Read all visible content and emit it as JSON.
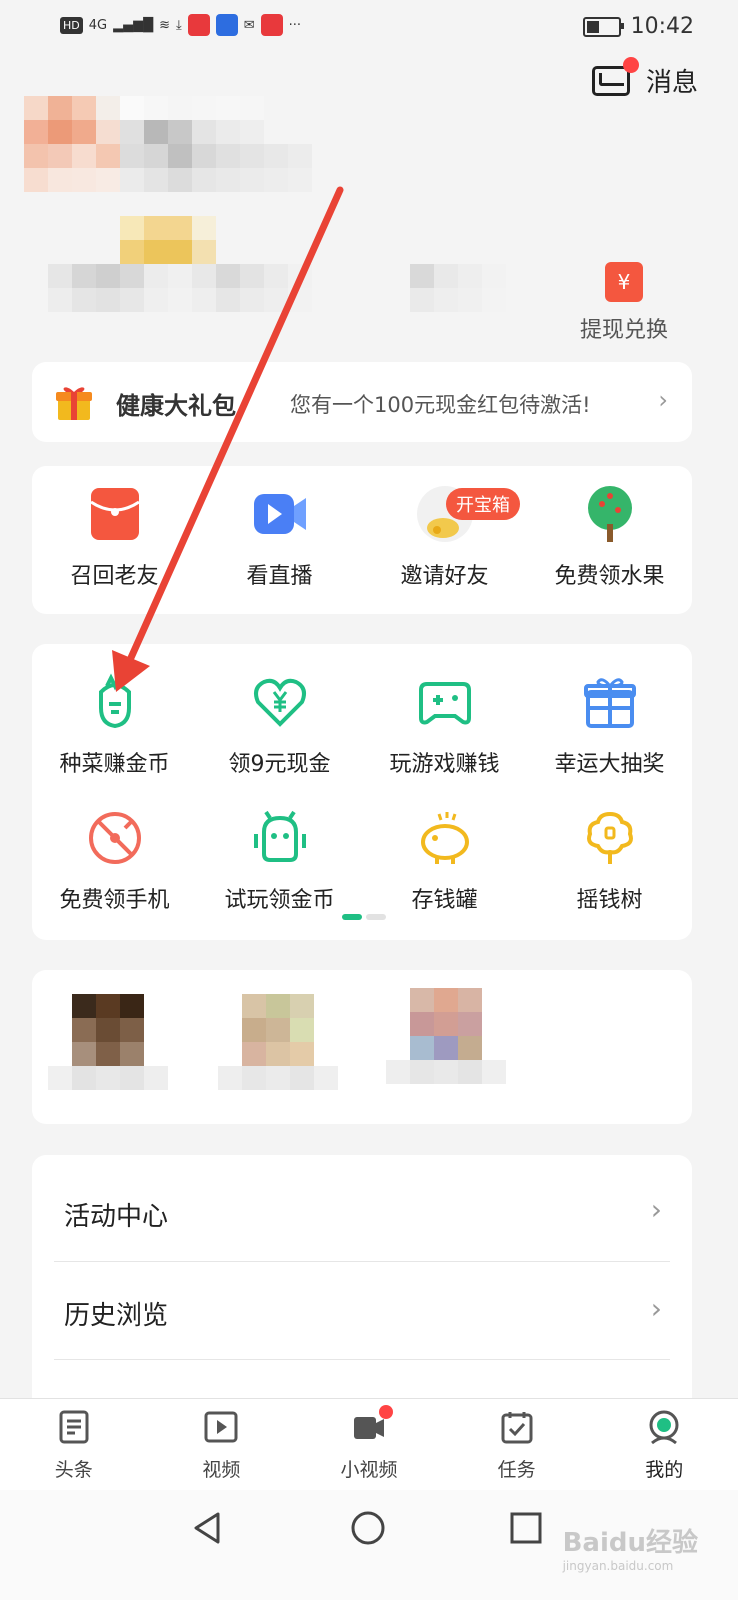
{
  "status_bar": {
    "time": "10:42",
    "network": "4G",
    "battery_percent": 45
  },
  "header": {
    "messages_label": "消息"
  },
  "profile": {
    "withdraw_label": "提现兑换",
    "withdraw_icon_char": "¥"
  },
  "gift_banner": {
    "title": "健康大礼包",
    "description": "您有一个100元现金红包待激活!",
    "chevron": "›"
  },
  "quick_row": {
    "badge": "开宝箱",
    "items": [
      {
        "label": "召回老友",
        "icon": "red-envelope-icon"
      },
      {
        "label": "看直播",
        "icon": "video-camera-icon"
      },
      {
        "label": "邀请好友",
        "icon": "treasure-box-icon"
      },
      {
        "label": "免费领水果",
        "icon": "fruit-tree-icon"
      }
    ]
  },
  "earn_grid": {
    "items": [
      {
        "label": "种菜赚金币",
        "icon": "vegetable-icon"
      },
      {
        "label": "领9元现金",
        "icon": "heart-yen-icon"
      },
      {
        "label": "玩游戏赚钱",
        "icon": "gamepad-icon"
      },
      {
        "label": "幸运大抽奖",
        "icon": "gift-box-icon"
      },
      {
        "label": "免费领手机",
        "icon": "phone-target-icon"
      },
      {
        "label": "试玩领金币",
        "icon": "android-robot-icon"
      },
      {
        "label": "存钱罐",
        "icon": "piggy-bank-icon"
      },
      {
        "label": "摇钱树",
        "icon": "money-tree-icon"
      }
    ],
    "page_count": 2,
    "active_page": 1
  },
  "list": {
    "items": [
      {
        "label": "活动中心"
      },
      {
        "label": "历史浏览"
      }
    ]
  },
  "bottom_nav": {
    "items": [
      {
        "label": "头条",
        "icon": "news-icon"
      },
      {
        "label": "视频",
        "icon": "video-play-icon"
      },
      {
        "label": "小视频",
        "icon": "camera-icon"
      },
      {
        "label": "任务",
        "icon": "calendar-task-icon"
      },
      {
        "label": "我的",
        "icon": "profile-icon"
      }
    ],
    "active_index": 4
  },
  "watermark": {
    "text": "Baidu经验",
    "sub": "jingyan.baidu.com"
  },
  "colors": {
    "accent_green": "#1fbf84",
    "red": "#f4573f",
    "blue": "#4a7ff5",
    "yellow": "#f2b91e",
    "arrow_red": "#e94335"
  }
}
